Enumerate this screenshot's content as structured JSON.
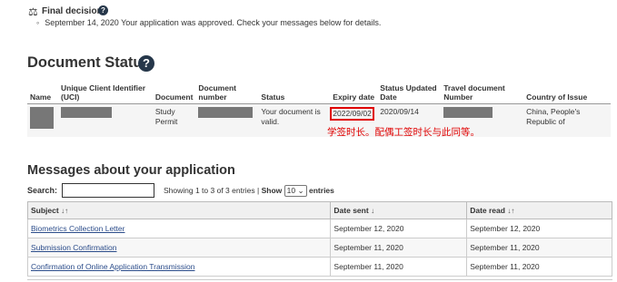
{
  "final_decision": {
    "title": "Final decision",
    "bullet": "September 14, 2020 Your application was approved. Check your messages below for details."
  },
  "document_status": {
    "title": "Document Status",
    "headers": [
      "Name",
      "Unique Client Identifier (UCI)",
      "Document",
      "Document number",
      "Status",
      "Expiry date",
      "Status Updated Date",
      "Travel document Number",
      "Country of Issue"
    ],
    "row": {
      "document": "Study Permit",
      "status": "Your document is valid.",
      "expiry": "2022/09/02",
      "updated": "2020/09/14",
      "country": "China, People's Republic of"
    },
    "annotation": "学签时长。配偶工签时长与此同等。",
    "annotation_color": "#e00000"
  },
  "messages": {
    "title": "Messages about your application",
    "search_label": "Search:",
    "search_value": "",
    "showing_text": "Showing 1 to 3 of 3 entries",
    "separator": "|",
    "show_label": "Show",
    "page_length": "10",
    "entries_label": "entries",
    "headers": {
      "subject": "Subject",
      "date_sent": "Date sent",
      "date_read": "Date read"
    },
    "sort_icons": {
      "subject": "↓↑",
      "date_sent": "↓",
      "date_read": "↓↑"
    },
    "rows": [
      {
        "subject": "Biometrics Collection Letter",
        "sent": "September 12, 2020",
        "read": "September 12, 2020"
      },
      {
        "subject": "Submission Confirmation",
        "sent": "September 11, 2020",
        "read": "September 11, 2020"
      },
      {
        "subject": "Confirmation of Online Application Transmission",
        "sent": "September 11, 2020",
        "read": "September 11, 2020"
      }
    ]
  },
  "icons": {
    "help": "?",
    "scale": "⚖",
    "dropdown": "⌄"
  }
}
